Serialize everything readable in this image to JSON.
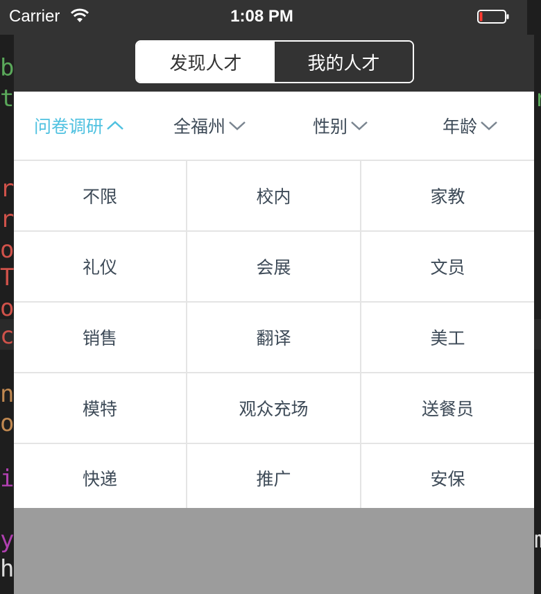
{
  "background": {
    "left_chars": [
      "b",
      "t",
      "r",
      "r",
      "o",
      "T",
      "o",
      "c",
      "n",
      "o",
      "i",
      "y",
      "h"
    ],
    "right_chars": [
      "r",
      "m"
    ]
  },
  "status_bar": {
    "carrier": "Carrier",
    "time": "1:08 PM",
    "wifi_icon": "wifi-icon",
    "battery_icon": "battery-low-icon"
  },
  "nav": {
    "segments": [
      {
        "label": "发现人才",
        "selected": true
      },
      {
        "label": "我的人才",
        "selected": false
      }
    ]
  },
  "filters": [
    {
      "label": "问卷调研",
      "icon": "chevron-up-icon",
      "active": true
    },
    {
      "label": "全福州",
      "icon": "chevron-down-icon",
      "active": false
    },
    {
      "label": "性别",
      "icon": "chevron-down-icon",
      "active": false
    },
    {
      "label": "年龄",
      "icon": "chevron-down-icon",
      "active": false
    }
  ],
  "categories": [
    "不限",
    "校内",
    "家教",
    "礼仪",
    "会展",
    "文员",
    "销售",
    "翻译",
    "美工",
    "模特",
    "观众充场",
    "送餐员",
    "快递",
    "推广",
    "安保"
  ],
  "colors": {
    "accent": "#4fc1e0",
    "text": "#3d4a57",
    "bar": "#333333",
    "divider": "#e4e4e4",
    "dim_overlay": "#9c9c9c"
  }
}
